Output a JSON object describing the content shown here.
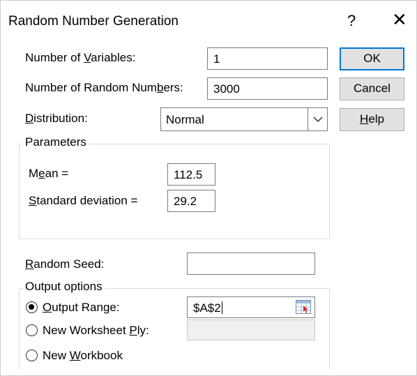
{
  "window": {
    "title": "Random Number Generation",
    "help_glyph": "?",
    "close_glyph": "✕"
  },
  "fields": {
    "num_variables": {
      "label_pre": "Number of ",
      "label_key": "V",
      "label_post": "ariables:",
      "value": "1"
    },
    "num_random": {
      "label_pre": "Number of Random Num",
      "label_key": "b",
      "label_post": "ers:",
      "value": "3000"
    },
    "distribution": {
      "label_pre": "",
      "label_key": "D",
      "label_post": "istribution:",
      "value": "Normal"
    }
  },
  "buttons": {
    "ok": "OK",
    "cancel": "Cancel",
    "help_key": "H",
    "help_rest": "elp"
  },
  "parameters": {
    "title": "Parameters",
    "mean": {
      "label_pre": "M",
      "label_key": "e",
      "label_post": "an =",
      "value": "112.5"
    },
    "std": {
      "label_pre": "",
      "label_key": "S",
      "label_post": "tandard deviation =",
      "value": "29.2"
    }
  },
  "seed": {
    "label_pre": "",
    "label_key": "R",
    "label_post": "andom Seed:",
    "value": ""
  },
  "output": {
    "title": "Output options",
    "output_range": {
      "label_pre": "",
      "label_key": "O",
      "label_post": "utput Range:",
      "value": "$A$2",
      "selected": true
    },
    "new_sheet": {
      "label_pre": "New Worksheet ",
      "label_key": "P",
      "label_post": "ly:",
      "value": "",
      "selected": false
    },
    "new_workbook": {
      "label_pre": "New ",
      "label_key": "W",
      "label_post": "orkbook",
      "selected": false
    }
  },
  "icons": {
    "help": "question-mark",
    "close": "close-x",
    "dropdown": "chevron-down",
    "collapse": "range-selector"
  },
  "colors": {
    "default_button_border": "#0078d7",
    "button_bg": "#e1e1e1",
    "group_border": "#dcdcdc"
  }
}
